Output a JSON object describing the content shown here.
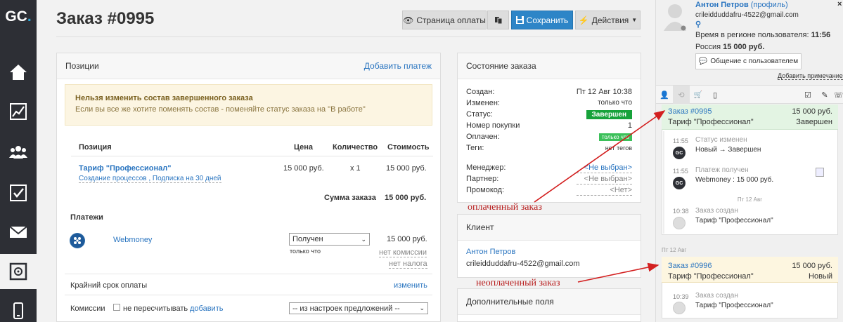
{
  "sidebar": {
    "logo_main": "GC",
    "logo_dot": "."
  },
  "header": {
    "title": "Заказ #0995",
    "btn_payment_page": "Страница оплаты",
    "btn_save": "Сохранить",
    "btn_actions": "Действия"
  },
  "positions": {
    "title": "Позиции",
    "add_payment": "Добавить платеж",
    "warning_title": "Нельзя изменить состав завершенного заказа",
    "warning_text": "Если вы все же хотите поменять состав - поменяйте статус заказа на \"В работе\"",
    "col_position": "Позиция",
    "col_price": "Цена",
    "col_qty": "Количество",
    "col_cost": "Стоимость",
    "item_name": "Тариф \"Профессионал\"",
    "item_sub": "Создание процессов , Подписка на 30 дней",
    "item_price": "15 000 руб.",
    "item_qty": "x 1",
    "item_cost": "15 000 руб.",
    "sum_label": "Сумма заказа",
    "sum_value": "15 000 руб.",
    "payments_title": "Платежи",
    "payment_method": "Webmoney",
    "payment_status": "Получен",
    "payment_time": "только что",
    "payment_amount": "15 000 руб.",
    "no_commission": "нет комиссии",
    "no_tax": "нет налога",
    "deadline_label": "Крайний срок оплаты",
    "deadline_action": "изменить",
    "commission_label": "Комиссии",
    "no_recalc": "не пересчитывать",
    "add": "добавить",
    "from_settings": "-- из настроек предложений --"
  },
  "order_state": {
    "title": "Состояние заказа",
    "created_label": "Создан:",
    "created_value": "Пт 12 Авг 10:38",
    "changed_label": "Изменен:",
    "changed_value": "только что",
    "status_label": "Статус:",
    "status_value": "Завершен",
    "purchase_label": "Номер покупки",
    "purchase_value": "1",
    "paid_label": "Оплачен:",
    "paid_value": "только что",
    "tags_label": "Теги:",
    "tags_value": "нет тегов",
    "manager_label": "Менеджер:",
    "manager_value": "<Не выбран>",
    "partner_label": "Партнер:",
    "partner_value": "<Не выбран>",
    "promo_label": "Промокод:",
    "promo_value": "<Нет>"
  },
  "client": {
    "title": "Клиент",
    "name": "Антон Петров",
    "email": "crileidduddafru-4522@gmail.com"
  },
  "extra_fields": {
    "title": "Дополнительные поля"
  },
  "annotations": {
    "paid": "оплаченный заказ",
    "unpaid": "неоплаченный заказ"
  },
  "user_panel": {
    "name": "Антон Петров",
    "profile_link": "(профиль)",
    "email": "crileidduddafru-4522@gmail.com",
    "time_label": "Время в регионе пользователя:",
    "time_value": "11:56",
    "country": "Россия",
    "amount": "15 000 руб.",
    "chat_button": "Общение с пользователем",
    "add_note": "Добавить примечание",
    "orders": [
      {
        "title": "Заказ #0995",
        "amount": "15 000 руб.",
        "tariff": "Тариф \"Профессионал\"",
        "status": "Завершен"
      },
      {
        "title": "Заказ #0996",
        "amount": "15 000 руб.",
        "tariff": "Тариф \"Профессионал\"",
        "status": "Новый"
      }
    ],
    "events": [
      {
        "time": "11:55",
        "title": "Статус изменен",
        "text": "Новый → Завершен"
      },
      {
        "time": "11:55",
        "title": "Платеж получен",
        "text": "Webmoney : 15 000 руб."
      },
      {
        "time": "10:38",
        "title": "Заказ создан",
        "text": "Тариф \"Профессионал\""
      },
      {
        "time": "10:39",
        "title": "Заказ создан",
        "text": "Тариф \"Профессионал\""
      }
    ],
    "date_sep_1": "Пт 12 Авг",
    "date_sep_2": "Пт 12 Авг"
  },
  "colors": {
    "sidebar": "#2d2f35",
    "accent": "#2a75c0",
    "status_done": "#17a23a",
    "annotation": "#d32020",
    "paid_order_bg": "#e3f4e3",
    "unpaid_order_bg": "#fdf6e0"
  }
}
